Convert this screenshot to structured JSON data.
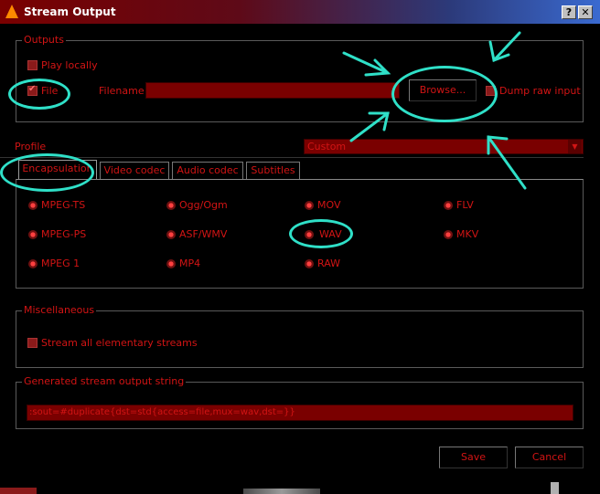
{
  "window": {
    "title": "Stream Output",
    "help": "?",
    "close": "✕"
  },
  "outputs": {
    "group_label": "Outputs",
    "play_locally": {
      "label": "Play locally",
      "checked": false
    },
    "file": {
      "label": "File",
      "checked": true
    },
    "filename_label": "Filename",
    "filename_value": "",
    "browse_label": "Browse...",
    "dump_raw": {
      "label": "Dump raw input",
      "checked": false
    }
  },
  "profile": {
    "label": "Profile",
    "value": "Custom"
  },
  "tabs": [
    {
      "label": "Encapsulation",
      "active": true
    },
    {
      "label": "Video codec",
      "active": false
    },
    {
      "label": "Audio codec",
      "active": false
    },
    {
      "label": "Subtitles",
      "active": false
    }
  ],
  "encapsulation": {
    "options": [
      "MPEG-TS",
      "Ogg/Ogm",
      "MOV",
      "FLV",
      "MPEG-PS",
      "ASF/WMV",
      "WAV",
      "MKV",
      "MPEG 1",
      "MP4",
      "RAW"
    ],
    "selected": "WAV"
  },
  "misc": {
    "group_label": "Miscellaneous",
    "stream_all": {
      "label": "Stream all elementary streams",
      "checked": false
    }
  },
  "sout": {
    "group_label": "Generated stream output string",
    "value": ":sout=#duplicate{dst=std{access=file,mux=wav,dst=}}"
  },
  "buttons": {
    "save": "Save",
    "cancel": "Cancel"
  },
  "colors": {
    "accent": "#d21414",
    "field": "#7a0000",
    "annotation": "#2fe0c8"
  }
}
